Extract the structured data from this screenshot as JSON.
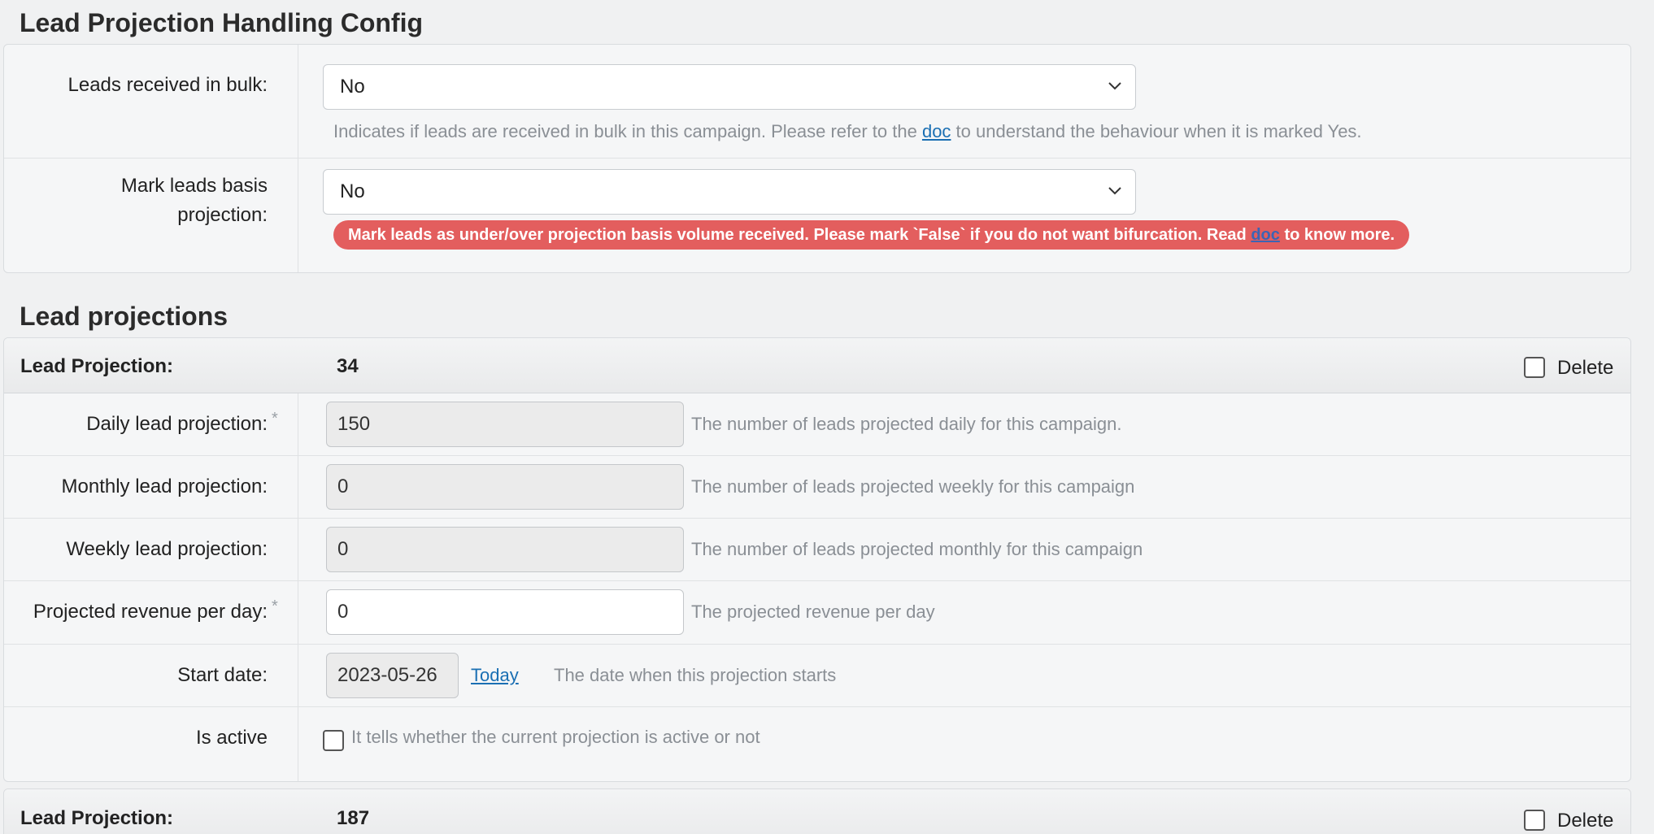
{
  "config": {
    "title": "Lead Projection Handling Config",
    "bulk": {
      "label": "Leads received in bulk:",
      "value": "No",
      "help_before": "Indicates if leads are received in bulk in this campaign. Please refer to the ",
      "help_link": "doc",
      "help_after": " to understand the behaviour when it is marked Yes."
    },
    "basis": {
      "label_line1": "Mark leads basis",
      "label_line2": "projection:",
      "value": "No",
      "badge_before": "Mark leads as under/over projection basis volume received. Please mark `False` if you do not want bifurcation. Read ",
      "badge_link": "doc",
      "badge_after": " to know more."
    }
  },
  "projections": {
    "title": "Lead projections",
    "items": [
      {
        "header_label": "Lead Projection:",
        "id": "34",
        "delete_label": "Delete",
        "daily": {
          "label": "Daily lead projection:",
          "value": "150",
          "help": "The number of leads projected daily for this campaign."
        },
        "monthly": {
          "label": "Monthly lead projection:",
          "value": "0",
          "help": "The number of leads projected weekly for this campaign"
        },
        "weekly": {
          "label": "Weekly lead projection:",
          "value": "0",
          "help": "The number of leads projected monthly for this campaign"
        },
        "revenue": {
          "label": "Projected revenue per day:",
          "value": "0",
          "help": "The projected revenue per day"
        },
        "start": {
          "label": "Start date:",
          "value": "2023-05-26",
          "today": "Today",
          "help": "The date when this projection starts"
        },
        "active": {
          "label": "Is active",
          "help": "It tells whether the current projection is active or not"
        },
        "required_mark": "*"
      },
      {
        "header_label": "Lead Projection:",
        "id": "187",
        "delete_label": "Delete"
      }
    ]
  },
  "colors": {
    "badge": "#e35e5e",
    "link": "#1a6fb3"
  }
}
